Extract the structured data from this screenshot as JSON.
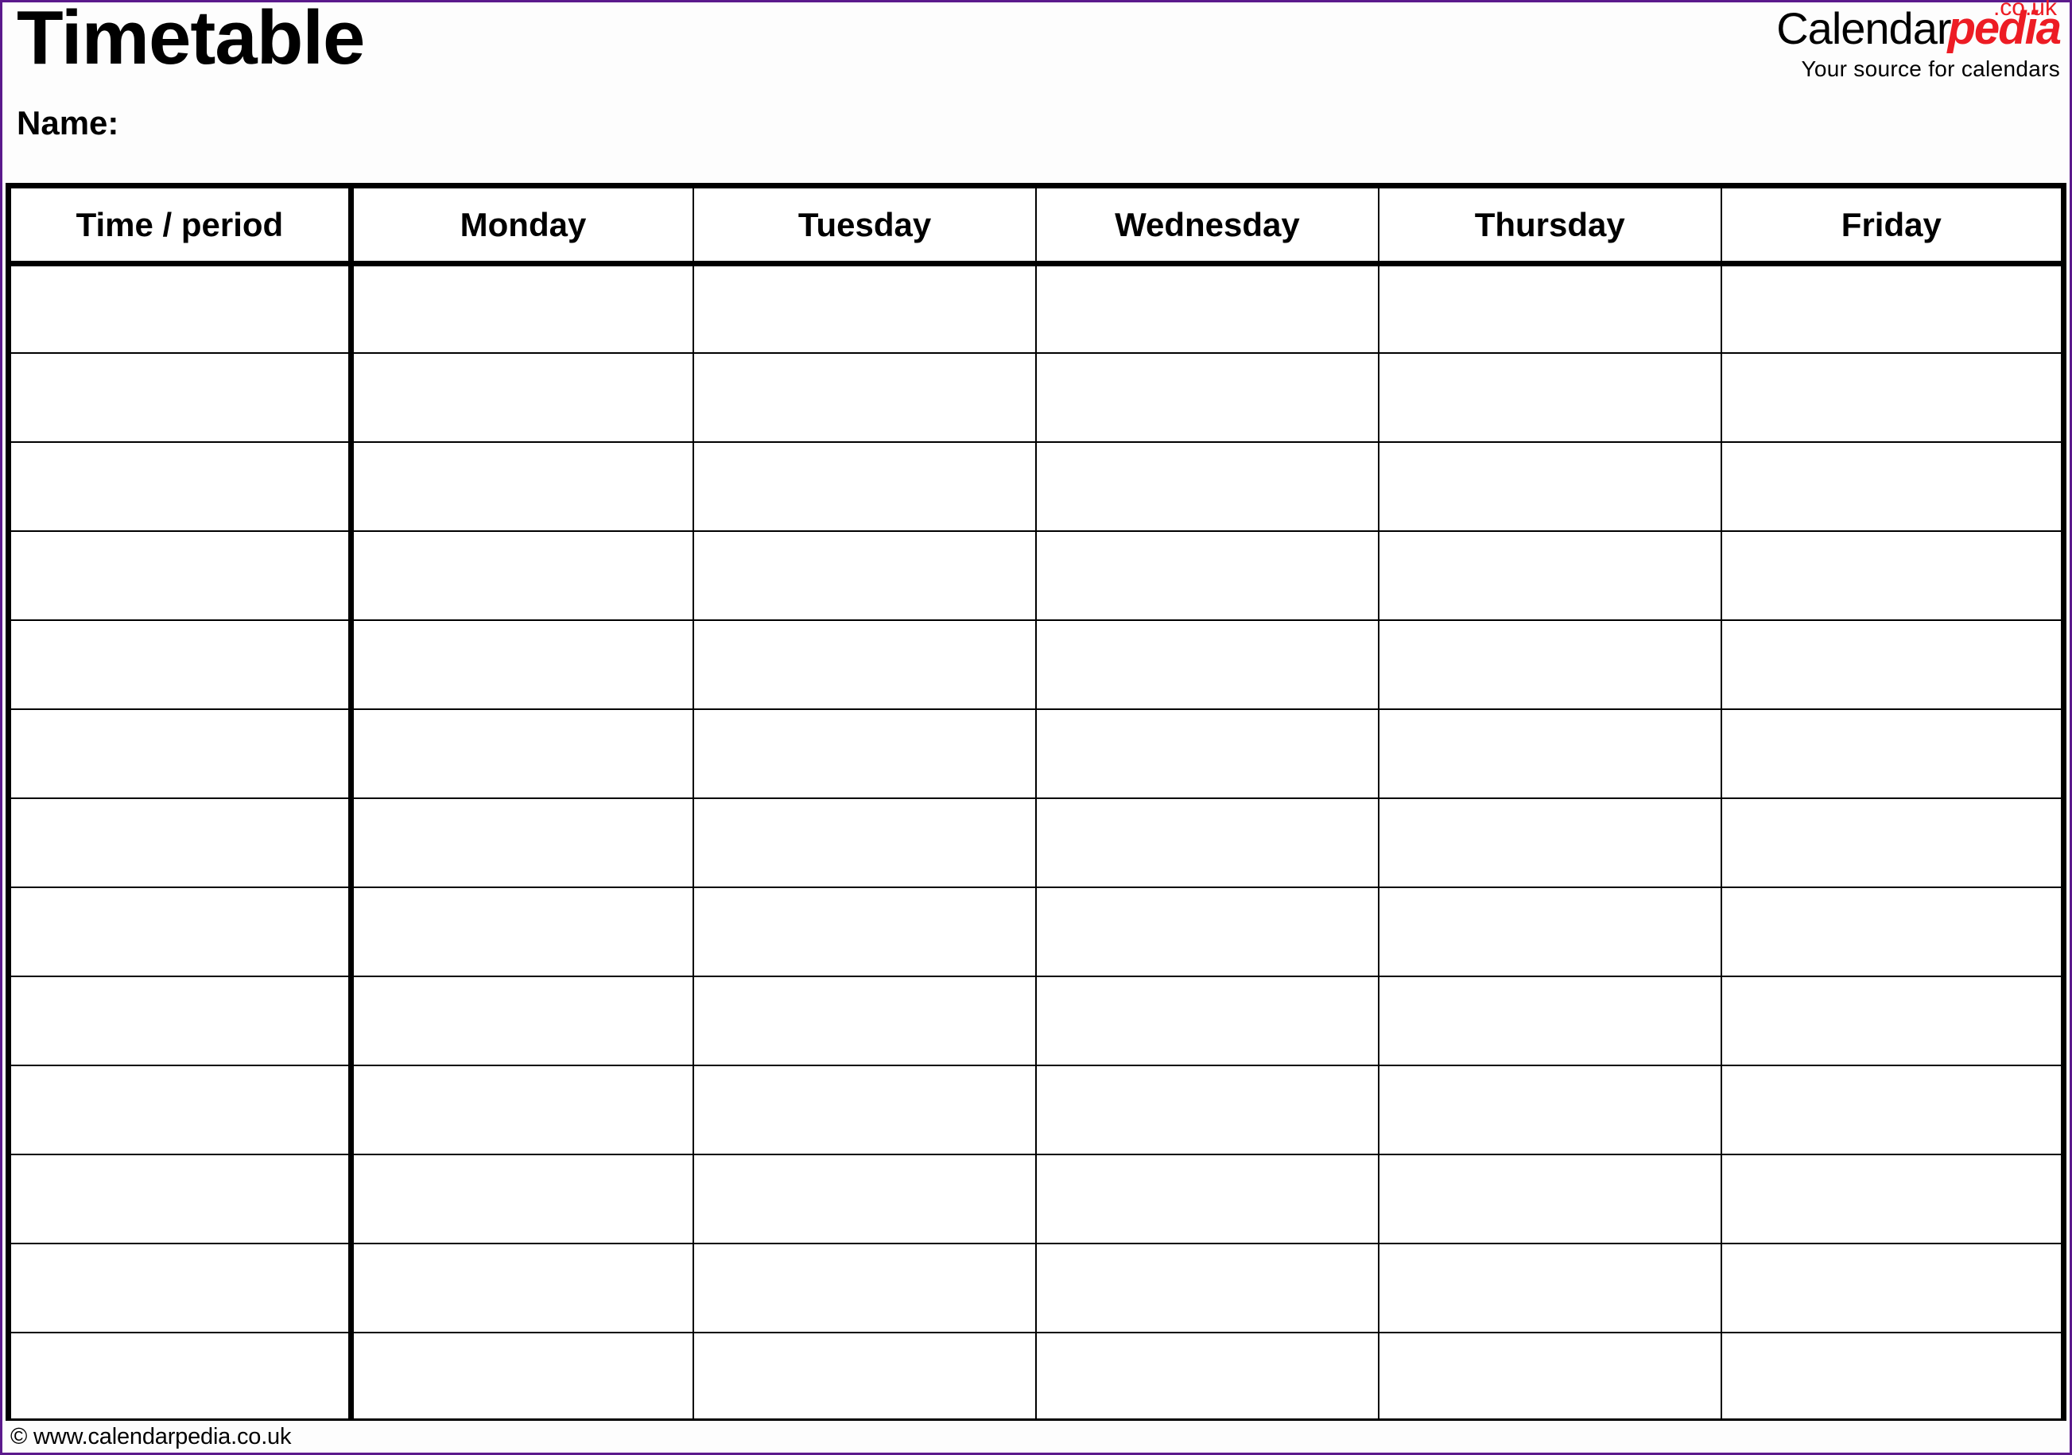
{
  "page": {
    "title": "Timetable",
    "border_color": "#5B1A8C",
    "background": "#ffffff"
  },
  "header": {
    "title": "Timetable",
    "name_label": "Name:",
    "name_value": ""
  },
  "brand": {
    "part_black": "Calendar",
    "part_red": "pedia",
    "tld": ".co.uk",
    "tagline": "Your source for calendars",
    "red_hex": "#ED1C24",
    "black_hex": "#000000"
  },
  "table": {
    "columns": [
      "Time / period",
      "Monday",
      "Tuesday",
      "Wednesday",
      "Thursday",
      "Friday"
    ],
    "row_count": 13,
    "rows": [
      [
        "",
        "",
        "",
        "",
        "",
        ""
      ],
      [
        "",
        "",
        "",
        "",
        "",
        ""
      ],
      [
        "",
        "",
        "",
        "",
        "",
        ""
      ],
      [
        "",
        "",
        "",
        "",
        "",
        ""
      ],
      [
        "",
        "",
        "",
        "",
        "",
        ""
      ],
      [
        "",
        "",
        "",
        "",
        "",
        ""
      ],
      [
        "",
        "",
        "",
        "",
        "",
        ""
      ],
      [
        "",
        "",
        "",
        "",
        "",
        ""
      ],
      [
        "",
        "",
        "",
        "",
        "",
        ""
      ],
      [
        "",
        "",
        "",
        "",
        "",
        ""
      ],
      [
        "",
        "",
        "",
        "",
        "",
        ""
      ],
      [
        "",
        "",
        "",
        "",
        "",
        ""
      ],
      [
        "",
        "",
        "",
        "",
        "",
        ""
      ]
    ]
  },
  "footer": {
    "copyright": "© www.calendarpedia.co.uk"
  }
}
